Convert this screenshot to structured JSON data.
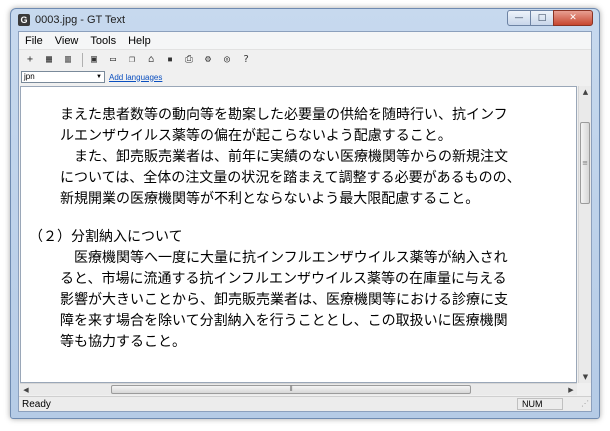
{
  "window": {
    "title": "0003.jpg - GT Text",
    "app_icon": "G"
  },
  "titlebar_buttons": {
    "minimize": "—",
    "maximize": "□",
    "close": "✕"
  },
  "menu": [
    "File",
    "View",
    "Tools",
    "Help"
  ],
  "toolbar": {
    "icons": [
      "add-icon",
      "grid-icon",
      "layout-icon",
      "panel-icon",
      "rect-icon",
      "copy-icon",
      "open-icon",
      "save-icon",
      "print-icon",
      "settings-icon",
      "help-icon"
    ]
  },
  "language": {
    "selected": "jpn",
    "add_link": "Add languages"
  },
  "document": {
    "lines": [
      "まえた患者数等の動向等を勘案した必要量の供給を随時行い、抗インフ",
      "ルエンザウイルス薬等の偏在が起こらないよう配慮すること。",
      "　また、卸売販売業者は、前年に実績のない医療機関等からの新規注文",
      "については、全体の注文量の状況を踏まえて調整する必要があるものの、",
      "新規開業の医療機関等が不利とならないよう最大限配慮すること。",
      "（２）分割納入について",
      "　医療機関等へ一度に大量に抗インフルエンザウイルス薬等が納入され",
      "ると、市場に流通する抗インフルエンザウイルス薬等の在庫量に与える",
      "影響が大きいことから、卸売販売業者は、医療機関等における診療に支",
      "障を来す場合を除いて分割納入を行うこととし、この取扱いに医療機関",
      "等も協力すること。"
    ]
  },
  "status": {
    "text": "Ready",
    "num": "NUM"
  }
}
